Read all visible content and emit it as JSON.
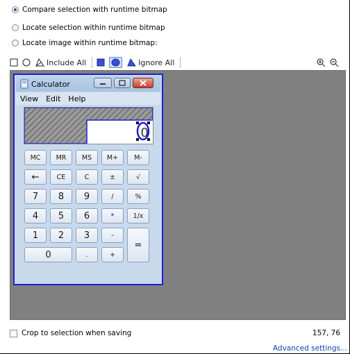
{
  "options": {
    "compare": "Compare selection with runtime bitmap",
    "locate_selection": "Locate selection within runtime bitmap",
    "locate_image": "Locate image within runtime bitmap:"
  },
  "toolbar": {
    "include_all": "Include All",
    "ignore_all": "Ignore All"
  },
  "calculator": {
    "title": "Calculator",
    "menu": [
      "View",
      "Edit",
      "Help"
    ],
    "display_value": "0",
    "rows": [
      [
        "MC",
        "MR",
        "MS",
        "M+",
        "M-"
      ],
      [
        "←",
        "CE",
        "C",
        "±",
        "√"
      ],
      [
        "7",
        "8",
        "9",
        "/",
        "%"
      ],
      [
        "4",
        "5",
        "6",
        "*",
        "1/x"
      ],
      [
        "1",
        "2",
        "3",
        "-",
        "="
      ],
      [
        "0",
        ".",
        "+"
      ]
    ]
  },
  "status": {
    "crop_label": "Crop to selection when saving",
    "coordinates": "157, 76",
    "advanced_link": "Advanced settings..."
  },
  "colors": {
    "selection_border": "#1f1fd8",
    "canvas_bg": "#808080",
    "link": "#0645ad"
  }
}
